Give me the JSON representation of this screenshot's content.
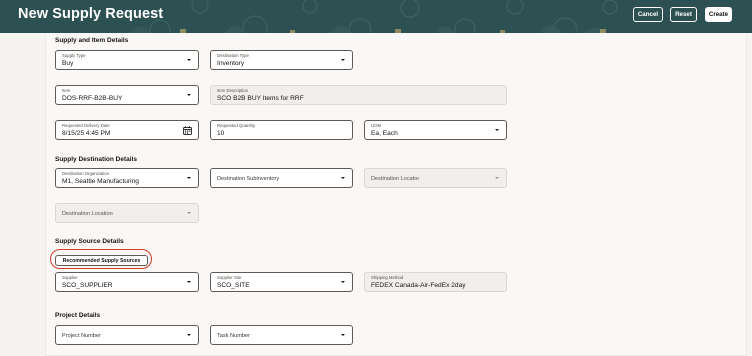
{
  "header": {
    "title": "New Supply Request",
    "buttons": {
      "cancel": "Cancel",
      "reset": "Reset",
      "create": "Create"
    },
    "bg_color": "#2d5052"
  },
  "sections": {
    "supply_item": "Supply and Item Details",
    "destination": "Supply Destination Details",
    "source": "Supply Source Details",
    "project": "Project Details"
  },
  "fields": {
    "supply_type": {
      "label": "Supply Type",
      "value": "Buy"
    },
    "destination_type": {
      "label": "Destination Type",
      "value": "Inventory"
    },
    "item": {
      "label": "Item",
      "value": "DOS-RRF-B2B-BUY"
    },
    "item_description": {
      "label": "Item Description",
      "value": "SCO B2B BUY Items for RRF"
    },
    "requested_delivery_date": {
      "label": "Requested Delivery Date",
      "value": "8/15/25 4:45 PM"
    },
    "requested_quantity": {
      "label": "Requested Quantity",
      "value": "10"
    },
    "uom": {
      "label": "UOM",
      "value": "Ea, Each"
    },
    "destination_organization": {
      "label": "Destination Organization",
      "value": "M1, Seattle Manufacturing"
    },
    "destination_subinventory": {
      "placeholder": "Destination Subinventory"
    },
    "destination_locator": {
      "placeholder": "Destination Locator"
    },
    "destination_location": {
      "placeholder": "Destination Location"
    },
    "supplier": {
      "label": "Supplier",
      "value": "SCO_SUPPLIER"
    },
    "supplier_site": {
      "label": "Supplier Site",
      "value": "SCO_SITE"
    },
    "shipping_method": {
      "label": "Shipping Method",
      "value": "FEDEX Canada-Air-FedEx 2day"
    },
    "project_number": {
      "placeholder": "Project Number"
    },
    "task_number": {
      "placeholder": "Task Number"
    }
  },
  "recommended_button": "Recommended Supply Sources",
  "highlight_color": "#d63b25"
}
